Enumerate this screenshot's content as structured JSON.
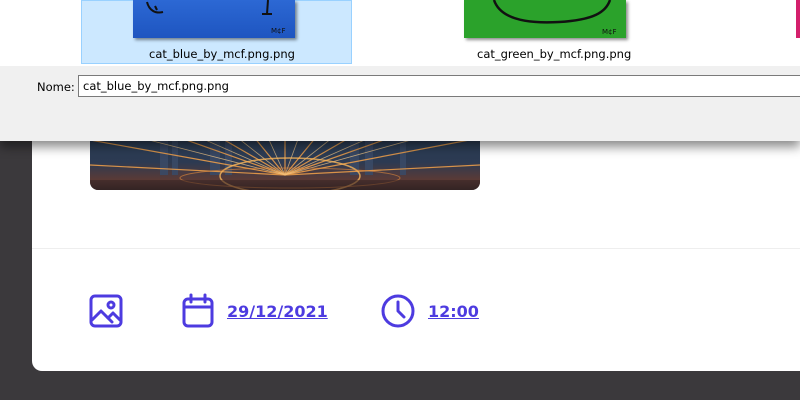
{
  "composer": {
    "date_label": "29/12/2021",
    "time_label": "12:00",
    "accent_color": "#4d3be0",
    "icons": {
      "image": "image-icon",
      "calendar": "calendar-icon",
      "clock": "clock-icon"
    }
  },
  "dialog": {
    "files": [
      {
        "name": "cat_blue_by_mcf.png.png",
        "selected": true,
        "signature": "M¢F"
      },
      {
        "name": "cat_green_by_mcf.png.png",
        "selected": false,
        "signature": "M¢F"
      }
    ],
    "name_label": "Nome:",
    "name_value": "cat_blue_by_mcf.png.png"
  }
}
